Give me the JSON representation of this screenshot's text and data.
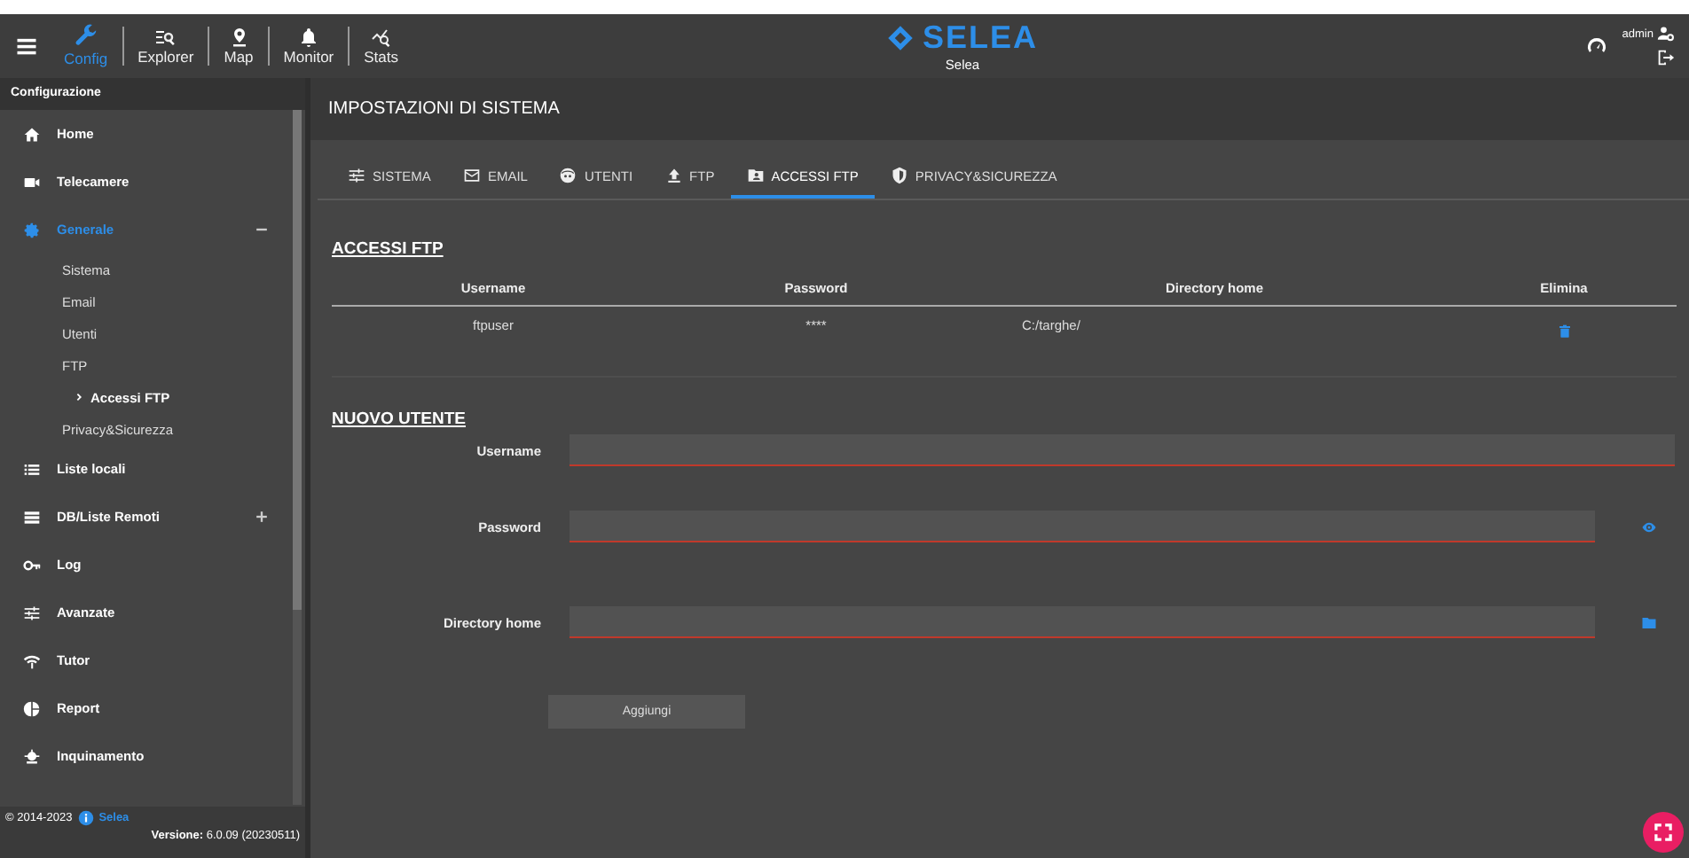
{
  "topbar": {
    "nav": [
      {
        "label": "Config",
        "selected": true
      },
      {
        "label": "Explorer",
        "selected": false
      },
      {
        "label": "Map",
        "selected": false
      },
      {
        "label": "Monitor",
        "selected": false
      },
      {
        "label": "Stats",
        "selected": false
      }
    ],
    "logo": {
      "name": "SELEA",
      "subtitle": "Selea"
    },
    "user": "admin"
  },
  "sidebar": {
    "header": "Configurazione",
    "items": [
      {
        "label": "Home",
        "selected": false
      },
      {
        "label": "Telecamere",
        "selected": false
      },
      {
        "label": "Generale",
        "selected": true,
        "expanded": true,
        "children": [
          {
            "label": "Sistema",
            "selected": false
          },
          {
            "label": "Email",
            "selected": false
          },
          {
            "label": "Utenti",
            "selected": false
          },
          {
            "label": "FTP",
            "selected": false,
            "children": [
              {
                "label": "Accessi FTP",
                "selected": true
              }
            ]
          },
          {
            "label": "Privacy&Sicurezza",
            "selected": false
          }
        ]
      },
      {
        "label": "Liste locali",
        "selected": false
      },
      {
        "label": "DB/Liste Remoti",
        "selected": false,
        "expanded": false
      },
      {
        "label": "Log",
        "selected": false
      },
      {
        "label": "Avanzate",
        "selected": false
      },
      {
        "label": "Tutor",
        "selected": false
      },
      {
        "label": "Report",
        "selected": false
      },
      {
        "label": "Inquinamento",
        "selected": false
      }
    ],
    "footer": {
      "copyright": "© 2014-2023",
      "link": "Selea",
      "version": "**Versione:** 6.0.09 (20230511)"
    }
  },
  "main": {
    "title": "IMPOSTAZIONI DI SISTEMA",
    "tabs": [
      {
        "label": "SISTEMA",
        "selected": false
      },
      {
        "label": "EMAIL",
        "selected": false
      },
      {
        "label": "UTENTI",
        "selected": false
      },
      {
        "label": "FTP",
        "selected": false
      },
      {
        "label": "ACCESSI FTP",
        "selected": true
      },
      {
        "label": "PRIVACY&SICUREZZA",
        "selected": false
      }
    ],
    "table": {
      "title": "ACCESSI FTP",
      "columns": [
        "Username",
        "Password",
        "Directory home",
        "Elimina"
      ],
      "rows": [
        {
          "cells": [
            "ftpuser",
            "****",
            "C:/targhe/"
          ]
        }
      ]
    },
    "form": {
      "title": "NUOVO UTENTE",
      "fields": [
        {
          "label": "Username",
          "kind": "text",
          "invalid": true
        },
        {
          "label": "Password",
          "kind": "password",
          "invalid": true
        },
        {
          "label": "Directory home",
          "kind": "folder",
          "invalid": true
        }
      ],
      "button": "Aggiungi"
    }
  }
}
